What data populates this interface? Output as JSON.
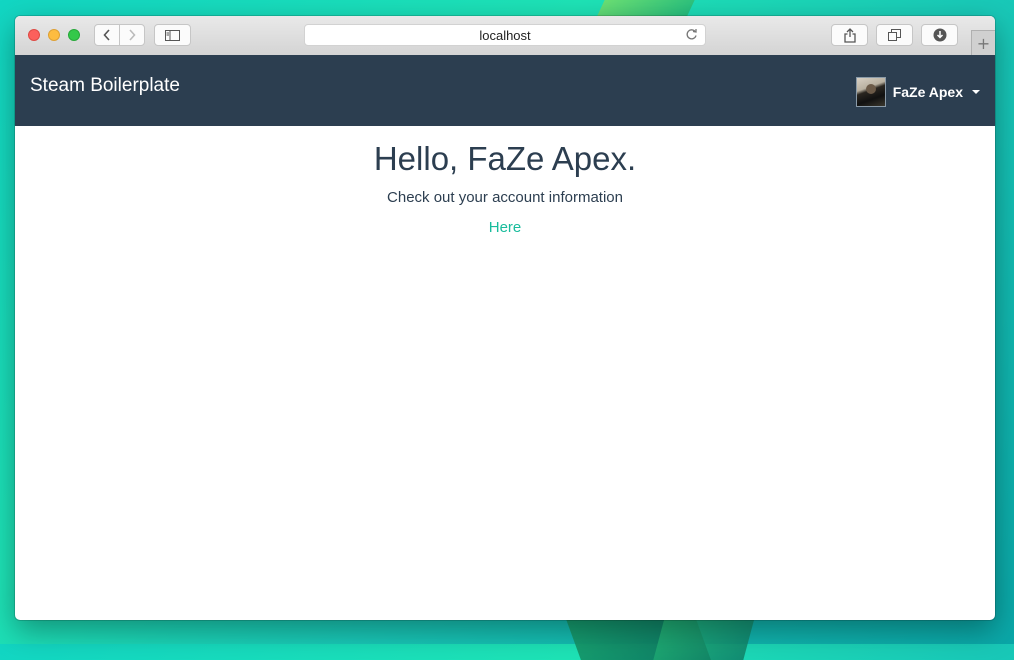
{
  "browser": {
    "url": "localhost",
    "icons": {
      "back": "chevron-left-icon",
      "forward": "chevron-right-icon",
      "sidebar": "sidebar-icon",
      "reload": "reload-icon",
      "share": "share-icon",
      "tabs": "tabs-overview-icon",
      "download": "download-icon",
      "new_tab": "plus-icon"
    }
  },
  "navbar": {
    "brand": "Steam Boilerplate",
    "user_name": "FaZe Apex",
    "background": "#2c3e50"
  },
  "main": {
    "greeting": "Hello, FaZe Apex.",
    "subtitle": "Check out your account information",
    "link_label": "Here",
    "link_color": "#18bc9c"
  }
}
